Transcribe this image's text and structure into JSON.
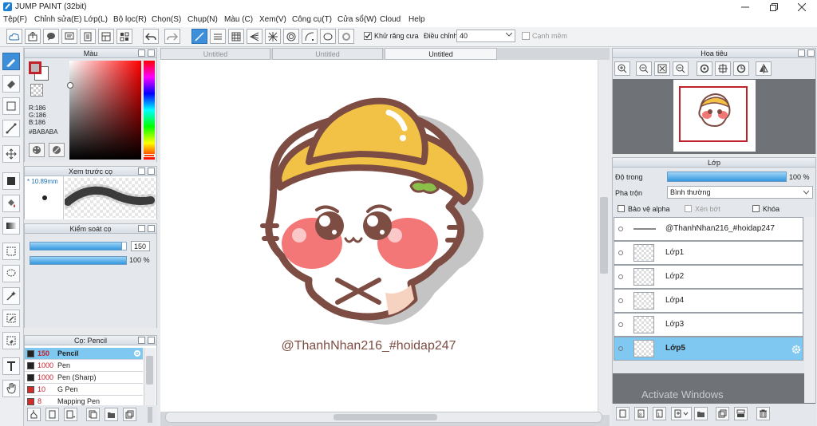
{
  "window": {
    "title": "JUMP PAINT (32bit)"
  },
  "menu": [
    "Tệp(F)",
    "Chỉnh sửa(E)",
    "Lớp(L)",
    "Bộ lọc(R)",
    "Chọn(S)",
    "Chụp(N)",
    "Màu (C)",
    "Xem(V)",
    "Công cụ(T)",
    "Cửa sổ(W)",
    "Cloud",
    "Help"
  ],
  "toolbar": {
    "antialias_label": "Khử răng cưa",
    "adjust_label": "Điều chỉnh",
    "adjust_value": "40",
    "edge_label": "Cạnh mềm"
  },
  "color_panel": {
    "title": "Màu",
    "r": "R:186",
    "g": "G:186",
    "b": "B:186",
    "hex": "#BABABA",
    "primary_color": "#c0222c",
    "secondary_color": "#bababa"
  },
  "preview_panel": {
    "title": "Xem trước cọ",
    "size": "10.89mm"
  },
  "brush_control": {
    "title": "Kiểm soát cọ",
    "size_value": "150",
    "opacity_value": "100 %",
    "size_fill": 0.95,
    "opacity_fill": 1.0
  },
  "brush_list": {
    "title": "Cọ: Pencil",
    "items": [
      {
        "size": "150",
        "name": "Pencil",
        "color": "#222222",
        "selected": true
      },
      {
        "size": "1000",
        "name": "Pen",
        "color": "#222222",
        "selected": false
      },
      {
        "size": "1000",
        "name": "Pen (Sharp)",
        "color": "#222222",
        "selected": false
      },
      {
        "size": "10",
        "name": "G Pen",
        "color": "#d42a2a",
        "selected": false
      },
      {
        "size": "8",
        "name": "Mapping Pen",
        "color": "#d42a2a",
        "selected": false
      }
    ]
  },
  "tabs": [
    "Untitled",
    "Untitled",
    "Untitled"
  ],
  "canvas": {
    "watermark": "@ThanhNhan216_#hoidap247"
  },
  "navigator": {
    "title": "Hoa tiêu"
  },
  "layer_panel": {
    "title": "Lớp",
    "opacity_label": "Độ trong",
    "opacity_value": "100 %",
    "opacity_fill": 1.0,
    "blend_label": "Pha trộn",
    "blend_value": "Bình thường",
    "protect_alpha": "Bảo vệ alpha",
    "clip": "Xén bớt",
    "lock": "Khóa",
    "layers": [
      {
        "name": "@ThanhNhan216_#hoidap247",
        "selected": false
      },
      {
        "name": "Lớp1",
        "selected": false
      },
      {
        "name": "Lớp2",
        "selected": false
      },
      {
        "name": "Lớp4",
        "selected": false
      },
      {
        "name": "Lớp3",
        "selected": false
      },
      {
        "name": "Lớp5",
        "selected": true
      }
    ]
  },
  "os_watermark": "Activate Windows"
}
